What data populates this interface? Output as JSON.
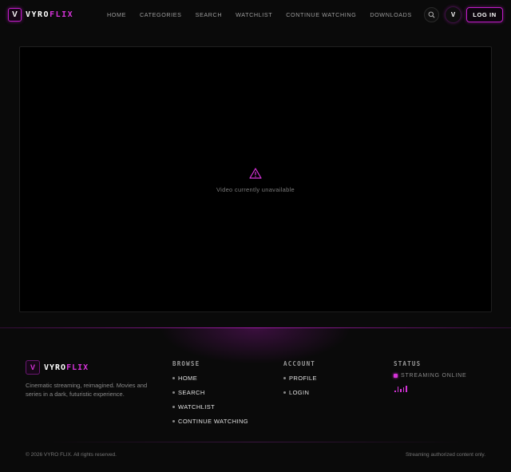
{
  "header": {
    "logo_letter": "V",
    "logo_part1": "VYRO",
    "logo_part2": "FLIX",
    "nav": [
      "HOME",
      "CATEGORIES",
      "SEARCH",
      "WATCHLIST",
      "CONTINUE WATCHING",
      "DOWNLOADS"
    ],
    "search_icon": "search-icon",
    "avatar_letter": "V",
    "login_label": "LOG IN"
  },
  "player": {
    "icon": "warning-icon",
    "message": "Video currently unavailable"
  },
  "footer": {
    "logo_letter": "V",
    "logo_part1": "VYRO",
    "logo_part2": "FLIX",
    "tagline": "Cinematic streaming, reimagined. Movies and series in a dark, futuristic experience.",
    "browse": {
      "title": "BROWSE",
      "links": [
        "HOME",
        "SEARCH",
        "WATCHLIST",
        "CONTINUE WATCHING"
      ]
    },
    "account": {
      "title": "ACCOUNT",
      "links": [
        "PROFILE",
        "LOGIN"
      ]
    },
    "status": {
      "title": "STATUS",
      "text": "STREAMING ONLINE",
      "icon": "equalizer-icon"
    },
    "copyright": "© 2026 VYRO FLIX. All rights reserved.",
    "legal": "Streaming authorized content only."
  },
  "colors": {
    "accent": "#d633d9",
    "background": "#0a0a0a"
  }
}
